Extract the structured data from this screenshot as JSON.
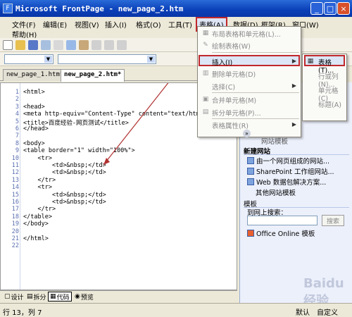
{
  "titlebar": {
    "title": "Microsoft FrontPage - new_page_2.htm"
  },
  "menubar": {
    "items": [
      "文件(F)",
      "编辑(E)",
      "视图(V)",
      "插入(I)",
      "格式(O)",
      "工具(T)",
      "表格(A)",
      "数据(D)",
      "框架(R)",
      "窗口(W)",
      "帮助(H)"
    ]
  },
  "tabs": {
    "items": [
      "new_page_1.htm*",
      "new_page_2.htm*"
    ]
  },
  "editor": {
    "lines": [
      {
        "num": "1",
        "code": "<html>"
      },
      {
        "num": "2",
        "code": ""
      },
      {
        "num": "3",
        "code": "<head>"
      },
      {
        "num": "4",
        "code": "<meta http-equiv=\"Content-Type\" content=\"text/html; ch"
      },
      {
        "num": "5",
        "code": "<title>百度经验-网页测试</title>"
      },
      {
        "num": "6",
        "code": "</head>"
      },
      {
        "num": "7",
        "code": ""
      },
      {
        "num": "8",
        "code": "<body>"
      },
      {
        "num": "9",
        "code": "<table border=\"1\" width=\"100%\">"
      },
      {
        "num": "10",
        "code": "    <tr>"
      },
      {
        "num": "11",
        "code": "        <td>&nbsp;</td>"
      },
      {
        "num": "12",
        "code": "        <td>&nbsp;</td>"
      },
      {
        "num": "13",
        "code": "    </tr>"
      },
      {
        "num": "14",
        "code": "    <tr>"
      },
      {
        "num": "15",
        "code": "        <td>&nbsp;</td>"
      },
      {
        "num": "16",
        "code": "        <td>&nbsp;</td>"
      },
      {
        "num": "17",
        "code": "    </tr>"
      },
      {
        "num": "18",
        "code": "</table>"
      },
      {
        "num": "19",
        "code": "</body>"
      },
      {
        "num": "20",
        "code": ""
      },
      {
        "num": "21",
        "code": "</html>"
      },
      {
        "num": "22",
        "code": ""
      }
    ]
  },
  "viewtabs": {
    "items": [
      "设计",
      "拆分",
      "代码",
      "预览"
    ],
    "active": "代码"
  },
  "statusbar": {
    "position": "行 13，列 7",
    "mode1": "默认",
    "mode2": "自定义"
  },
  "dropdown": {
    "items": [
      "布局表格和单元格(L)...",
      "绘制表格(W)",
      "插入(I)",
      "删除单元格(D)",
      "选择(C)",
      "合并单元格(M)",
      "拆分单元格(P)...",
      "表格属性(R)"
    ],
    "expand_glyph": "»"
  },
  "submenu": {
    "items": [
      "表格(T)...",
      "行或列(N)...",
      "单元格(C)",
      "标题(A)"
    ]
  },
  "taskpane": {
    "line_top": "网站模板",
    "section_new": "新建网站",
    "items": [
      "由一个网页组成的网站...",
      "SharePoint 工作组网站...",
      "Web 数据包解决方案...",
      "其他网站模板"
    ],
    "section_tpl": "模板",
    "search_label": "到网上搜索：",
    "search_button": "搜索",
    "online": "Office Online 模板"
  },
  "colors": {
    "title": "#0a3fb8",
    "highlight": "#c0282c",
    "arrow": "#b03030"
  }
}
